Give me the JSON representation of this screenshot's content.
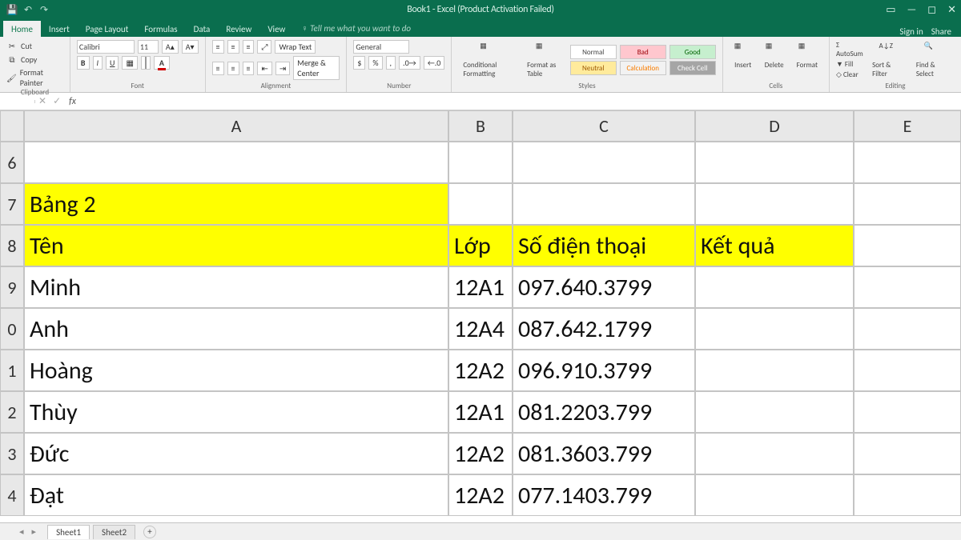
{
  "window": {
    "title": "Book1 - Excel (Product Activation Failed)",
    "sign_in": "Sign in"
  },
  "qat": {
    "save": "save-icon",
    "undo": "undo-icon",
    "redo": "redo-icon"
  },
  "tabs": {
    "home": "Home",
    "insert": "Insert",
    "pagelayout": "Page Layout",
    "formulas": "Formulas",
    "data": "Data",
    "review": "Review",
    "view": "View",
    "tell": "Tell me what you want to do",
    "share": "Share"
  },
  "ribbon": {
    "clipboard": {
      "cut": "Cut",
      "copy": "Copy",
      "painter": "Format Painter",
      "label": "Clipboard"
    },
    "font": {
      "name": "Calibri",
      "size": "11",
      "bold": "B",
      "italic": "I",
      "underline": "U",
      "label": "Font"
    },
    "alignment": {
      "wrap": "Wrap Text",
      "merge": "Merge & Center",
      "label": "Alignment"
    },
    "number": {
      "format": "General",
      "label": "Number"
    },
    "styles": {
      "condfmt": "Conditional Formatting",
      "table": "Format as Table",
      "normal": "Normal",
      "bad": "Bad",
      "good": "Good",
      "neutral": "Neutral",
      "calc": "Calculation",
      "check": "Check Cell",
      "label": "Styles"
    },
    "cells": {
      "insert": "Insert",
      "delete": "Delete",
      "format": "Format",
      "label": "Cells"
    },
    "editing": {
      "autosum": "AutoSum",
      "fill": "Fill",
      "clear": "Clear",
      "sort": "Sort & Filter",
      "find": "Find & Select",
      "label": "Editing"
    }
  },
  "namebox": "",
  "columns": {
    "A": "A",
    "B": "B",
    "C": "C",
    "D": "D",
    "E": "E"
  },
  "rows": {
    "r6": "6",
    "r7": "7",
    "r8": "8",
    "r9": "9",
    "r10": "0",
    "r11": "1",
    "r12": "2",
    "r13": "3",
    "r14": "4"
  },
  "data": {
    "r7": {
      "A": "Bảng 2"
    },
    "r8": {
      "A": "Tên",
      "B": "Lớp",
      "C": "Số điện thoại",
      "D": "Kết quả"
    },
    "r9": {
      "A": "Minh",
      "B": "12A1",
      "C": "097.640.3799"
    },
    "r10": {
      "A": "Anh",
      "B": "12A4",
      "C": "087.642.1799"
    },
    "r11": {
      "A": "Hoàng",
      "B": "12A2",
      "C": "096.910.3799"
    },
    "r12": {
      "A": "Thùy",
      "B": "12A1",
      "C": "081.2203.799"
    },
    "r13": {
      "A": "Đức",
      "B": "12A2",
      "C": "081.3603.799"
    },
    "r14": {
      "A": "Đạt",
      "B": "12A2",
      "C": "077.1403.799"
    }
  },
  "sheets": {
    "s1": "Sheet1",
    "s2": "Sheet2"
  }
}
